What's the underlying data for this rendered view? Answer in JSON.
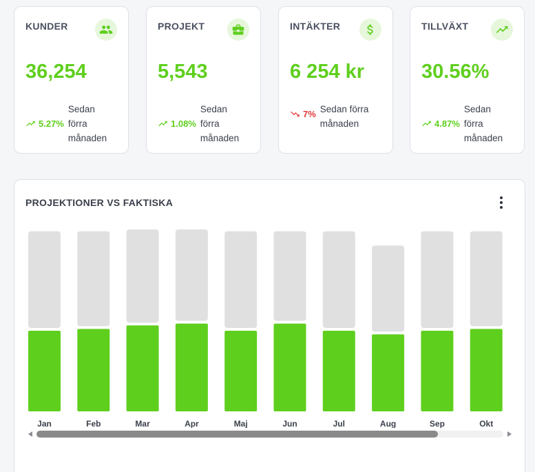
{
  "stats": [
    {
      "title": "KUNDER",
      "icon": "people-icon",
      "value": "36,254",
      "delta": "5.27%",
      "direction": "up",
      "caption": "Sedan förra månaden"
    },
    {
      "title": "PROJEKT",
      "icon": "briefcase-icon",
      "value": "5,543",
      "delta": "1.08%",
      "direction": "up",
      "caption": "Sedan förra månaden"
    },
    {
      "title": "INTÄKTER",
      "icon": "dollar-icon",
      "value": "6 254 kr",
      "delta": "7%",
      "direction": "down",
      "caption": "Sedan förra månaden"
    },
    {
      "title": "TILLVÄXT",
      "icon": "trending-up-icon",
      "value": "30.56%",
      "delta": "4.87%",
      "direction": "up",
      "caption": "Sedan förra månaden"
    }
  ],
  "colors": {
    "accent": "#5fcf1e",
    "negative": "#e03838",
    "icon_bg": "#e6f7dc",
    "projection": "#e0e0e0"
  },
  "chart_panel": {
    "title": "PROJEKTIONER VS FAKTISKA",
    "menu_icon": "more-vertical-icon"
  },
  "chart_data": {
    "type": "bar",
    "stacked": true,
    "categories": [
      "Jan",
      "Feb",
      "Mar",
      "Apr",
      "Maj",
      "Jun",
      "Jul",
      "Aug",
      "Sep",
      "Okt"
    ],
    "series": [
      {
        "values": [
          45,
          46,
          48,
          49,
          45,
          49,
          45,
          43,
          45,
          46
        ],
        "color": "#5fcf1e"
      },
      {
        "values": [
          54,
          53,
          52,
          51,
          54,
          50,
          54,
          48,
          54,
          53
        ],
        "color": "#e0e0e0"
      }
    ],
    "ylim": [
      0,
      100
    ],
    "grid": false,
    "legend": "none"
  },
  "scrollbar": {
    "position": 0,
    "visible_fraction": 0.86
  }
}
